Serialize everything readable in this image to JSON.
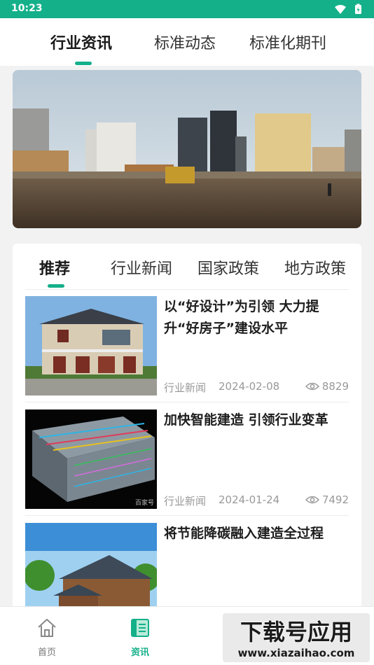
{
  "status_bar": {
    "time": "10:23",
    "icons": [
      "wifi-icon",
      "battery-icon"
    ]
  },
  "top_tabs": [
    {
      "label": "行业资讯",
      "active": true
    },
    {
      "label": "标准动态",
      "active": false
    },
    {
      "label": "标准化期刊",
      "active": false
    }
  ],
  "sub_tabs": [
    {
      "label": "推荐",
      "active": true
    },
    {
      "label": "行业新闻",
      "active": false
    },
    {
      "label": "国家政策",
      "active": false
    },
    {
      "label": "地方政策",
      "active": false
    }
  ],
  "news": [
    {
      "title": "以“好设计”为引领 大力提升“好房子”建设水平",
      "category": "行业新闻",
      "date": "2024-02-08",
      "views": "8829"
    },
    {
      "title": "加快智能建造 引领行业变革",
      "category": "行业新闻",
      "date": "2024-01-24",
      "views": "7492",
      "thumb_caption": "百家号"
    },
    {
      "title": "将节能降碳融入建造全过程",
      "category": "",
      "date": "",
      "views": ""
    }
  ],
  "bottom_nav": [
    {
      "label": "首页",
      "icon": "home-icon",
      "active": false
    },
    {
      "label": "资讯",
      "icon": "news-icon",
      "active": true
    }
  ],
  "watermark": {
    "text": "下载号应用",
    "url": "www.xiazaihao.com"
  },
  "colors": {
    "accent": "#14b08a",
    "status_bar": "#14b08a",
    "text_primary": "#1e1e1e",
    "text_secondary": "#999999"
  }
}
